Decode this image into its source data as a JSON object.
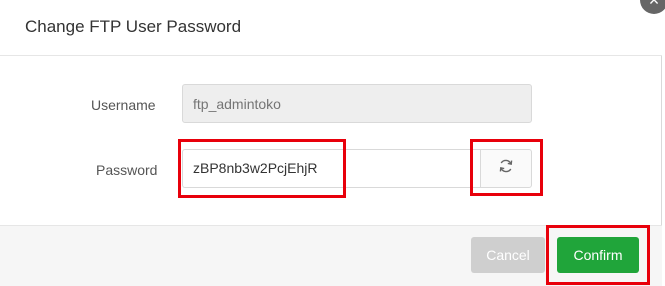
{
  "dialog": {
    "title": "Change FTP User Password",
    "close_icon": "close-icon"
  },
  "form": {
    "username_label": "Username",
    "username_placeholder": "ftp_admintoko",
    "password_label": "Password",
    "password_value": "zBP8nb3w2PcjEhjR",
    "refresh_icon": "refresh-icon"
  },
  "footer": {
    "cancel_label": "Cancel",
    "confirm_label": "Confirm"
  },
  "colors": {
    "confirm": "#20a53a",
    "highlight": "#e8000b",
    "cancel": "#cfcfcf"
  }
}
